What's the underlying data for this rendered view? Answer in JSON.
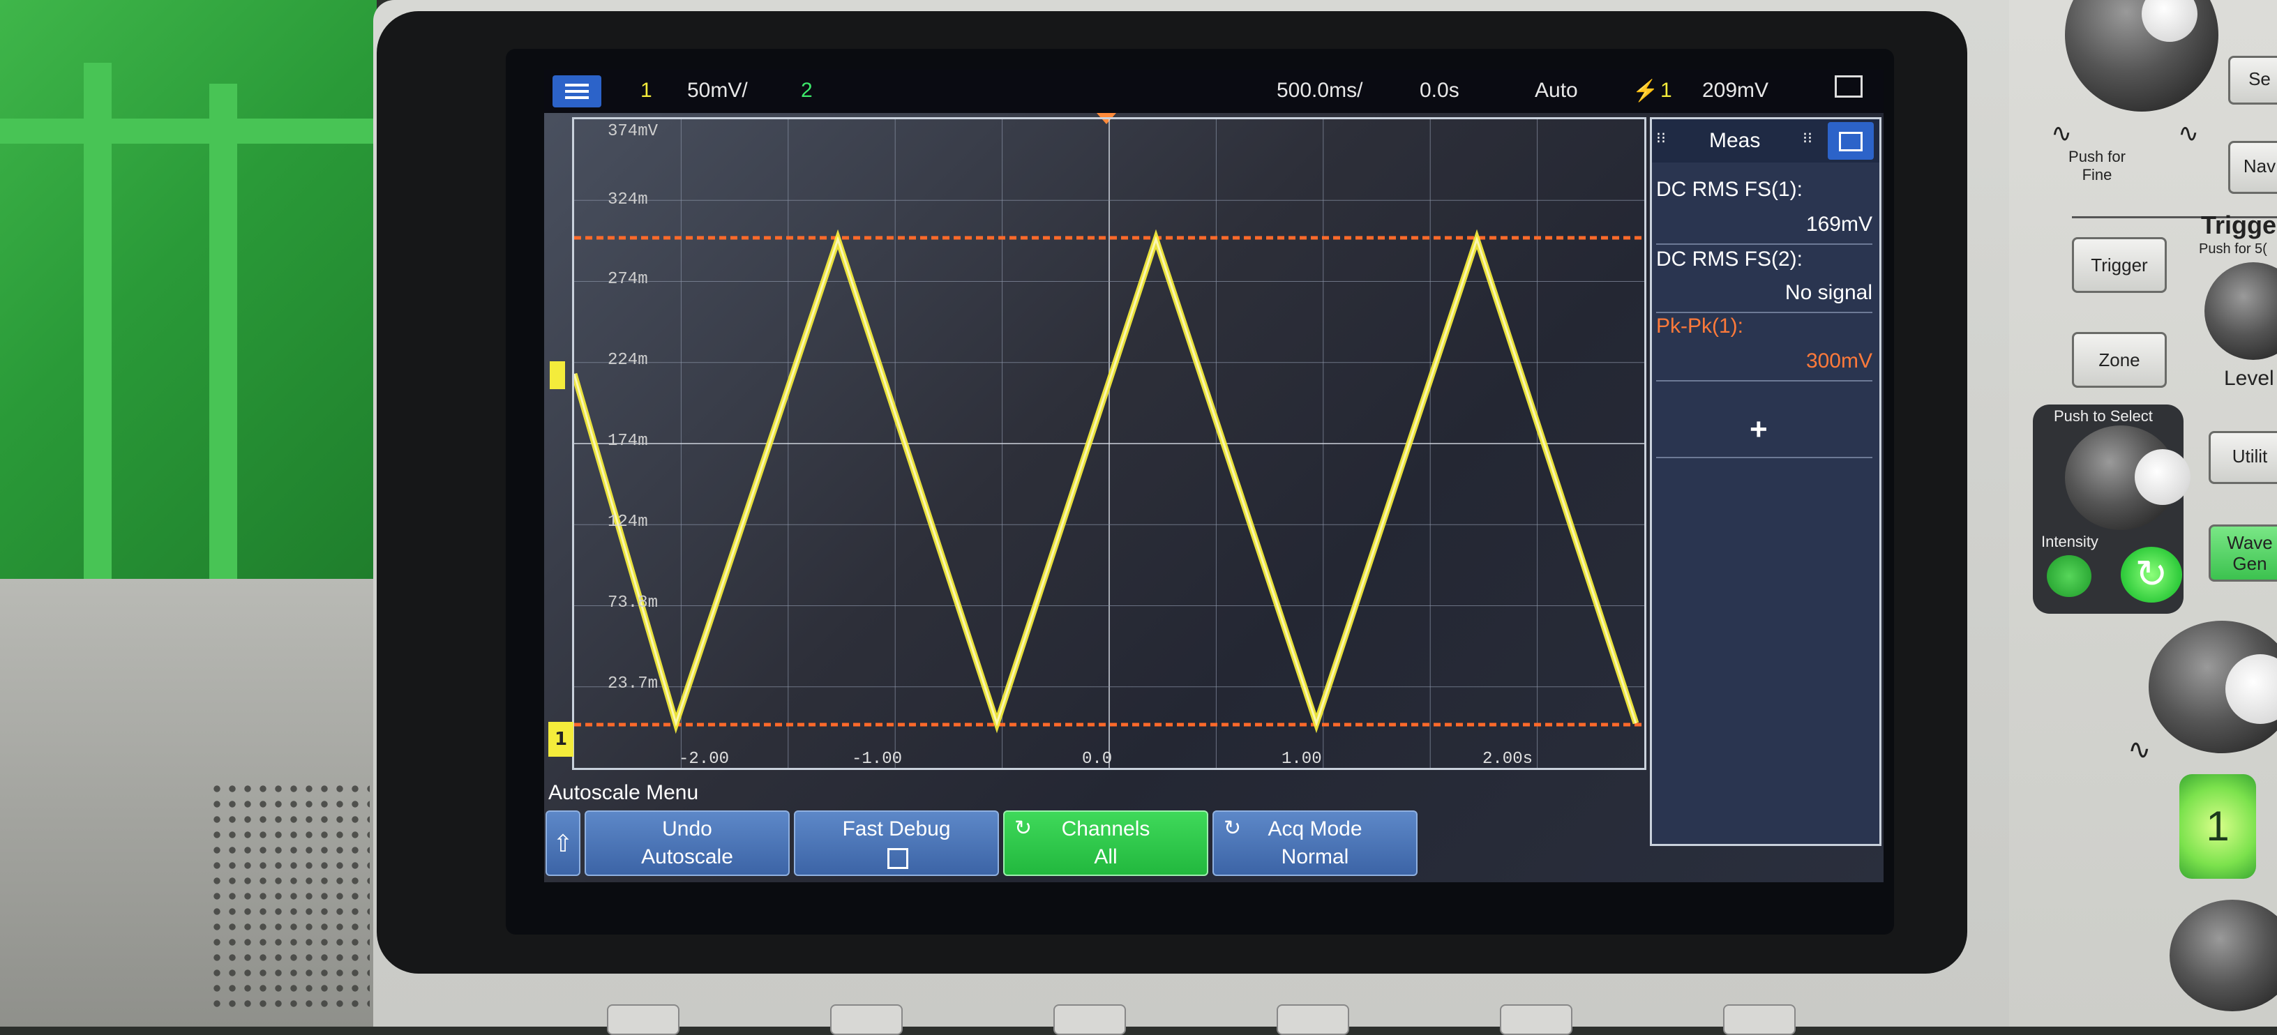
{
  "status_bar": {
    "channel1": "1",
    "ch1_scale": "50mV/",
    "channel2": "2",
    "timebase": "500.0ms/",
    "delay": "0.0s",
    "trigger_mode": "Auto",
    "trigger_channel": "1",
    "trigger_level": "209mV",
    "colors": {
      "ch1": "#f4ec3b",
      "ch2": "#3ce86a",
      "trigger": "#ffd24a"
    }
  },
  "plot": {
    "y_labels": [
      "374mV",
      "324m",
      "274m",
      "224m",
      "174m",
      "124m",
      "73.8m",
      "23.7m"
    ],
    "x_labels": [
      "-2.00",
      "-1.00",
      "0.0",
      "1.00",
      "2.00s"
    ],
    "ground_marker": "1",
    "trace_color": "#f4ec3b",
    "cursor_color": "#ff6a2a"
  },
  "meas_panel": {
    "title": "Meas",
    "rows": [
      {
        "label": "DC RMS FS(1):",
        "value": "169mV",
        "label_color": "#ffffff",
        "value_color": "#ffffff"
      },
      {
        "label": "DC RMS FS(2):",
        "value": "No signal",
        "label_color": "#ffffff",
        "value_color": "#ffffff"
      },
      {
        "label": "Pk-Pk(1):",
        "value": "300mV",
        "label_color": "#ff7a3a",
        "value_color": "#ff7a3a"
      }
    ],
    "add_symbol": "+"
  },
  "softkeys": {
    "menu_title": "Autoscale Menu",
    "keys": [
      {
        "line1": "Undo",
        "line2": "Autoscale"
      },
      {
        "line1": "Fast Debug",
        "line2": ""
      },
      {
        "line1": "Channels",
        "line2": "All"
      },
      {
        "line1": "Acq Mode",
        "line2": "Normal"
      }
    ]
  },
  "front_panel": {
    "push_for_fine": "Push for\nFine",
    "nav_btn": "Nav",
    "sel_btn": "Se",
    "trigger_header": "Trigge",
    "trigger_sub": "Push for 5(",
    "trigger_btn": "Trigger",
    "zone_btn": "Zone",
    "level_label": "Level",
    "push_to_select": "Push to Select",
    "intensity": "Intensity",
    "utility_btn": "Utilit",
    "wave_gen_btn": "Wave\nGen",
    "ch1_button": "1"
  }
}
